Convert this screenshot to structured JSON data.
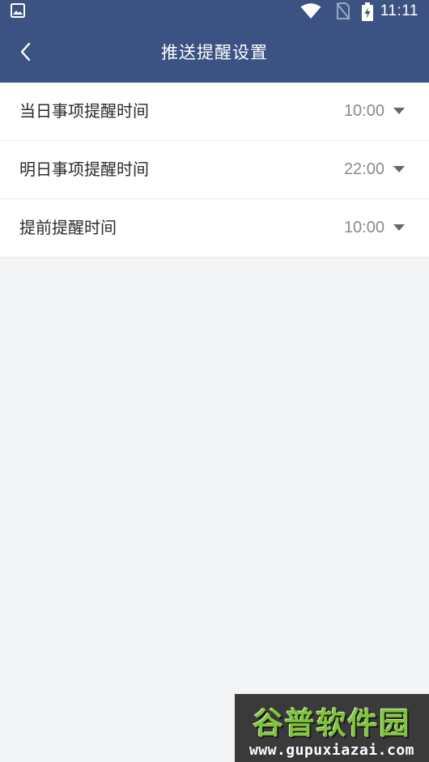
{
  "status_bar": {
    "time": "11:11"
  },
  "header": {
    "title": "推送提醒设置"
  },
  "settings": [
    {
      "label": "当日事项提醒时间",
      "value": "10:00"
    },
    {
      "label": "明日事项提醒时间",
      "value": "22:00"
    },
    {
      "label": "提前提醒时间",
      "value": "10:00"
    }
  ],
  "watermark": {
    "brand": "谷普软件园",
    "url": "www.gupuxiazai.com"
  },
  "colors": {
    "header_bg": "#3b5282",
    "page_bg": "#f3f4f6",
    "value_text": "#8a8a8a"
  }
}
